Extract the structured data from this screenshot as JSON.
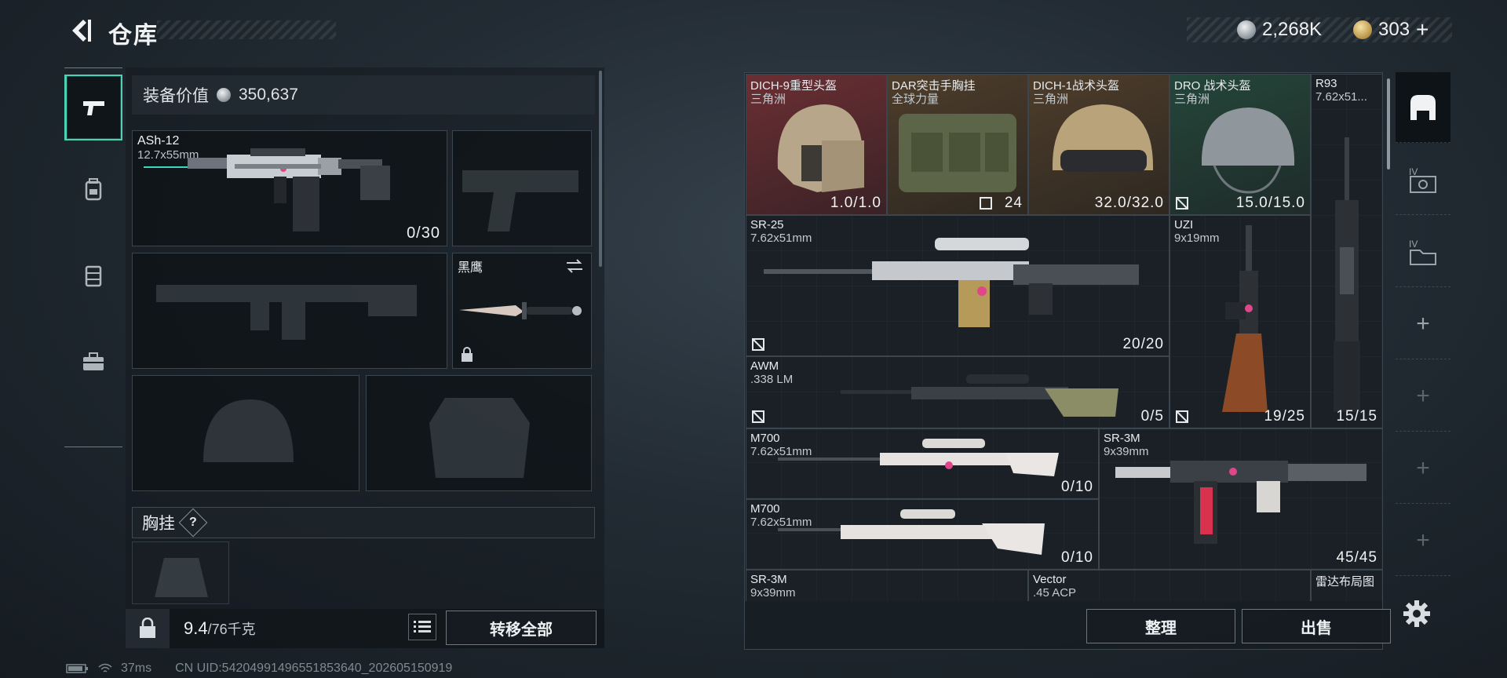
{
  "header": {
    "title": "仓库",
    "currencies": [
      {
        "icon": "silver-coin-icon",
        "amount": "2,268K"
      },
      {
        "icon": "gold-coin-icon",
        "amount": "303",
        "suffix": "+"
      }
    ]
  },
  "left_tabs": [
    {
      "icon": "pistol-icon",
      "active": true
    },
    {
      "icon": "backpack-icon",
      "active": false
    },
    {
      "icon": "vest-icon",
      "active": false
    },
    {
      "icon": "toolbox-icon",
      "active": false
    }
  ],
  "loadout": {
    "equip_value_label": "装备价值",
    "equip_value": "350,637",
    "primary": {
      "name": "ASh-12",
      "caliber": "12.7x55mm",
      "ammo": "0/30"
    },
    "secondary_empty": "pistol-silhouette",
    "melee": {
      "name": "黑鹰",
      "swap_icon": "swap-icon",
      "lock_icon": "lock-icon"
    },
    "chest_label": "胸挂",
    "help": "?"
  },
  "bottom_left": {
    "weight": "9.4",
    "weight_max": "/76千克",
    "transfer_all": "转移全部"
  },
  "storage": {
    "items": [
      {
        "name": "DICH-9重型头盔",
        "sub": "三角洲",
        "value": "1.0/1.0"
      },
      {
        "name": "DAR突击手胸挂",
        "sub": "全球力量",
        "value": "24"
      },
      {
        "name": "DICH-1战术头盔",
        "sub": "三角洲",
        "value": "32.0/32.0"
      },
      {
        "name": "DRO 战术头盔",
        "sub": "三角洲",
        "value": "15.0/15.0"
      },
      {
        "name": "R93",
        "sub": "7.62x51...",
        "value": "15/15"
      },
      {
        "name": "SR-25",
        "sub": "7.62x51mm",
        "value": "20/20"
      },
      {
        "name": "UZI",
        "sub": "9x19mm",
        "value": "19/25"
      },
      {
        "name": "AWM",
        "sub": ".338 LM",
        "value": "0/5"
      },
      {
        "name": "M700",
        "sub": "7.62x51mm",
        "value": "0/10"
      },
      {
        "name": "SR-3M",
        "sub": "9x39mm",
        "value": "45/45"
      },
      {
        "name": "M700",
        "sub": "7.62x51mm",
        "value": "0/10"
      },
      {
        "name": "SR-3M",
        "sub": "9x39mm",
        "value": ""
      },
      {
        "name": "Vector",
        "sub": ".45 ACP",
        "value": ""
      },
      {
        "name": "雷达布局图",
        "sub": "",
        "value": ""
      }
    ],
    "sort_label": "整理",
    "sell_label": "出售"
  },
  "right_strip": [
    {
      "icon": "storage-case-icon",
      "active": true
    },
    {
      "icon": "case-iv-icon"
    },
    {
      "icon": "case-iv-2-icon"
    },
    {
      "icon": "add-icon",
      "label": "+"
    },
    {
      "icon": "add-icon",
      "label": "+"
    },
    {
      "icon": "add-icon",
      "label": "+"
    },
    {
      "icon": "add-icon",
      "label": "+"
    }
  ],
  "status": {
    "ping": "37ms",
    "uid": "CN UID:54204991496551853640_202605150919"
  },
  "colors": {
    "accent": "#4fd0b5",
    "red_rarity": "#5a2a2d",
    "orange_rarity": "#4a3a2a",
    "green_rarity": "#22382f"
  }
}
